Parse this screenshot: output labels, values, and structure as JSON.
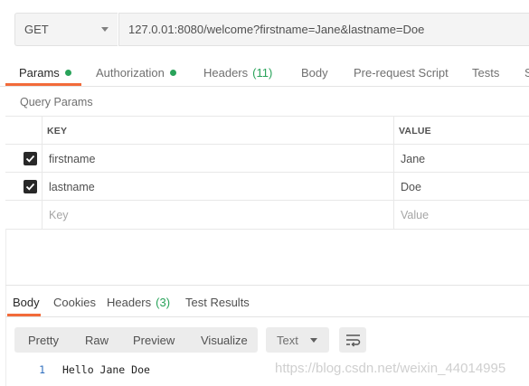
{
  "request": {
    "method": "GET",
    "url": "127.0.01:8080/welcome?firstname=Jane&lastname=Doe"
  },
  "request_tabs": {
    "params": "Params",
    "authorization": "Authorization",
    "headers": "Headers",
    "headers_count": "(11)",
    "body": "Body",
    "pre_request": "Pre-request Script",
    "tests": "Tests",
    "settings_partial": "S"
  },
  "query_params": {
    "title": "Query Params",
    "col_key": "KEY",
    "col_value": "VALUE",
    "rows": [
      {
        "checked": true,
        "key": "firstname",
        "value": "Jane"
      },
      {
        "checked": true,
        "key": "lastname",
        "value": "Doe"
      }
    ],
    "placeholder_key": "Key",
    "placeholder_value": "Value"
  },
  "response_tabs": {
    "body": "Body",
    "cookies": "Cookies",
    "headers": "Headers",
    "headers_count": "(3)",
    "test_results": "Test Results"
  },
  "view_modes": {
    "pretty": "Pretty",
    "raw": "Raw",
    "preview": "Preview",
    "visualize": "Visualize"
  },
  "format_select": "Text",
  "response_body": {
    "line_number": "1",
    "content": "Hello Jane Doe"
  },
  "watermark": "https://blog.csdn.net/weixin_44014995",
  "icons": {
    "method_dropdown": "chevron-down-icon",
    "checkbox": "check-icon",
    "wrap": "wrap-lines-icon"
  },
  "colors": {
    "accent": "#f26b3a",
    "status_green": "#29a35a",
    "checkbox": "#282828"
  }
}
